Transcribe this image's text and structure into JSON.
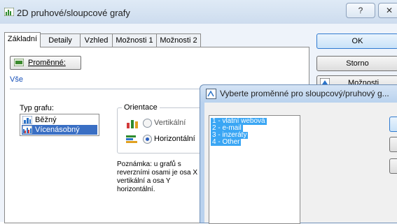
{
  "window": {
    "title": "2D pruhové/sloupcové grafy",
    "help_glyph": "?",
    "close_glyph": "✕"
  },
  "tabs": [
    {
      "label": "Základní",
      "active": true
    },
    {
      "label": "Detaily",
      "active": false
    },
    {
      "label": "Vzhled",
      "active": false
    },
    {
      "label": "Možnosti 1",
      "active": false
    },
    {
      "label": "Možnosti 2",
      "active": false
    }
  ],
  "variables_button": {
    "label": "Proměnné:"
  },
  "selected_vars_text": "Vše",
  "chart_type": {
    "label": "Typ grafu:",
    "items": [
      {
        "label": "Běžný",
        "selected": false
      },
      {
        "label": "Vícenásobný",
        "selected": true
      }
    ]
  },
  "orientation": {
    "legend": "Orientace",
    "options": [
      {
        "label": "Vertikální",
        "checked": false
      },
      {
        "label": "Horizontální",
        "checked": true
      }
    ]
  },
  "note": "Poznámka: u grafů s reverzními osami je osa X vertikální a osa Y horizontální.",
  "side_buttons": {
    "ok": "OK",
    "cancel": "Storno",
    "options": "Možnosti"
  },
  "dialog": {
    "title": "Vyberte proměnné pro sloupcový/pruhový g...",
    "variables": [
      "1 - vlatní webová",
      "2 - e-mail",
      "3 - inzeráty",
      "4 - Other"
    ]
  },
  "colors": {
    "accent": "#3a6fc4",
    "list_highlight": "#3aa6f4",
    "dialog_frame": "#b9d2ee"
  }
}
